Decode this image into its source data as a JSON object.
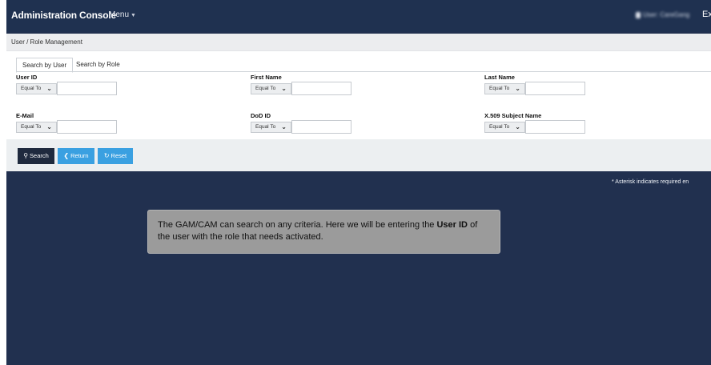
{
  "topbar": {
    "title": "Administration Console",
    "menu_label": "Menu",
    "user_label": "User: CareGang",
    "exit_label": "Exi"
  },
  "breadcrumb": "User / Role Management",
  "tabs": [
    {
      "label": "Search by User",
      "active": true
    },
    {
      "label": "Search by Role",
      "active": false
    }
  ],
  "fields": [
    {
      "label": "User ID",
      "operator": "Equal To",
      "value": ""
    },
    {
      "label": "First Name",
      "operator": "Equal To",
      "value": ""
    },
    {
      "label": "Last Name",
      "operator": "Equal To",
      "value": ""
    },
    {
      "label": "E-Mail",
      "operator": "Equal To",
      "value": ""
    },
    {
      "label": "DoD ID",
      "operator": "Equal To",
      "value": ""
    },
    {
      "label": "X.509 Subject Name",
      "operator": "Equal To",
      "value": ""
    }
  ],
  "buttons": {
    "search": "Search",
    "return": "Return",
    "reset": "Reset"
  },
  "asterisk_note": "* Asterisk indicates required en",
  "callout": {
    "text_before": "The GAM/CAM can search on any criteria. Here we will be entering the ",
    "emphasis": "User ID",
    "text_after": " of the user with the role that needs activated."
  },
  "colors": {
    "background": "#21304f",
    "accent": "#3aa0e1",
    "dark_button": "#1f2a3e"
  },
  "icons": {
    "search": "search-icon",
    "return": "chevron-left-icon",
    "reset": "refresh-icon",
    "dropdown": "chevron-down-icon"
  }
}
